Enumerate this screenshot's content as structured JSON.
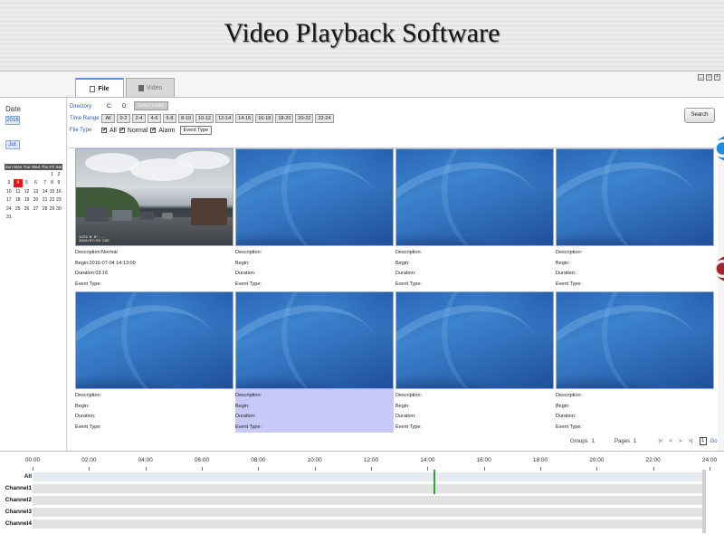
{
  "banner": {
    "title": "Video Playback Software"
  },
  "tabs": [
    {
      "label": "File",
      "icon": "file-icon",
      "active": true
    },
    {
      "label": "Video",
      "icon": "video-icon",
      "active": false
    }
  ],
  "sidebar": {
    "date_label": "Date",
    "year": "2016",
    "month": "Jul.",
    "calendar": {
      "weekdays": [
        "Sun",
        "Mon",
        "Tue",
        "Wed",
        "Thu",
        "Fri",
        "Sat"
      ],
      "weeks": [
        [
          "",
          "",
          "",
          "",
          "",
          "1",
          "2"
        ],
        [
          "3",
          "4",
          "5",
          "6",
          "7",
          "8",
          "9"
        ],
        [
          "10",
          "11",
          "12",
          "13",
          "14",
          "15",
          "16"
        ],
        [
          "17",
          "18",
          "19",
          "20",
          "21",
          "22",
          "23"
        ],
        [
          "24",
          "25",
          "26",
          "27",
          "28",
          "29",
          "30"
        ],
        [
          "31",
          "",
          "",
          "",
          "",
          "",
          ""
        ]
      ],
      "selected_day": "4"
    }
  },
  "filter": {
    "directory_label": "Directory",
    "drive_c": "C:",
    "drive_d": "D:",
    "select_folder": "Select Folder",
    "time_range_label": "Time Range",
    "ranges": [
      "All",
      "0-2",
      "2-4",
      "4-6",
      "6-8",
      "8-10",
      "10-12",
      "12-14",
      "14-16",
      "16-18",
      "18-20",
      "20-22",
      "22-24"
    ],
    "file_type_label": "File Type",
    "types": [
      {
        "label": "All",
        "checked": true
      },
      {
        "label": "Normal",
        "checked": true
      },
      {
        "label": "Alarm",
        "checked": true
      }
    ],
    "event_type_button": "Event Type",
    "search_button": "Search",
    "check_glyph": "✔"
  },
  "grid": {
    "items": [
      {
        "thumb": "photo",
        "description": "Description:Normal",
        "begin": "Begin:2016-07-04 14:13:09",
        "duration": "Duration:03:16",
        "event_type": "Event Type:",
        "osd_line1": "1279 N 8°...",
        "osd_line2": "2016/07/04  CGE"
      },
      {
        "thumb": "blank",
        "description": "Description:",
        "begin": "Begin:",
        "duration": "Duration:",
        "event_type": "Event Type:"
      },
      {
        "thumb": "blank",
        "description": "Description:",
        "begin": "Begin:",
        "duration": "Duration:",
        "event_type": "Event Type:"
      },
      {
        "thumb": "blank",
        "description": "Description:",
        "begin": "Begin:",
        "duration": "Duration:",
        "event_type": "Event Type:"
      },
      {
        "thumb": "blank",
        "description": "Description:",
        "begin": "Begin:",
        "duration": "Duration:",
        "event_type": "Event Type:"
      },
      {
        "thumb": "blank",
        "description": "Description:",
        "begin": "Begin:",
        "duration": "Duration:",
        "event_type": "Event Type:",
        "selected": true
      },
      {
        "thumb": "blank",
        "description": "Description:",
        "begin": "Begin:",
        "duration": "Duration:",
        "event_type": "Event Type:"
      },
      {
        "thumb": "blank",
        "description": "Description:",
        "begin": "Begin:",
        "duration": "Duration:",
        "event_type": "Event Type:"
      }
    ]
  },
  "pagination": {
    "groups_label": "Groups",
    "groups_value": "1",
    "pages_label": "Pages",
    "pages_value": "1",
    "first": "|<",
    "prev": "<",
    "next": ">",
    "last": ">|",
    "page_input": "1",
    "go": "Go"
  },
  "timeline": {
    "ticks": [
      "00:00",
      "02:00",
      "04:00",
      "06:00",
      "08:00",
      "10:00",
      "12:00",
      "14:00",
      "16:00",
      "18:00",
      "20:00",
      "22:00",
      "24:00"
    ],
    "channels": [
      "All",
      "Channel1",
      "Channel2",
      "Channel3",
      "Channel4"
    ],
    "marker_time": "14:13:09",
    "marker_color": "#2fa82f"
  },
  "window_controls": [
    "minimize-icon",
    "restore-icon",
    "close-icon"
  ]
}
